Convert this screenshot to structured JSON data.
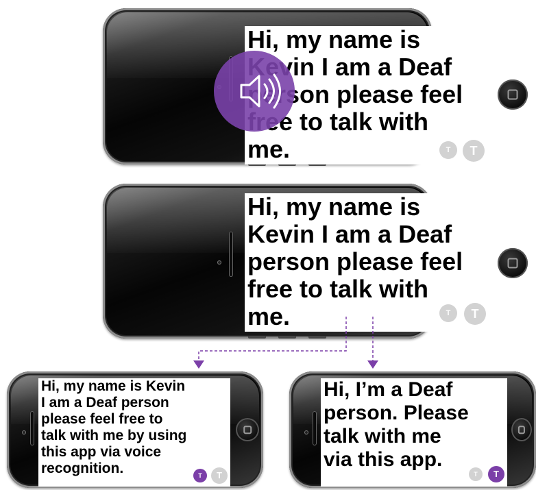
{
  "phones": {
    "top": {
      "message": "Hi, my name is\nKevin I am a Deaf\nperson please feel\nfree to talk with\nme.",
      "small_button": "T",
      "large_button": "T"
    },
    "middle": {
      "message": "Hi, my name is\nKevin I am a Deaf\nperson please feel\nfree to talk with\nme.",
      "small_button": "T",
      "large_button": "T"
    },
    "bottom_left": {
      "message": "Hi, my name is Kevin\nI am a Deaf person\nplease feel free to\ntalk with me by using\nthis app via voice\nrecognition.",
      "small_button": "T",
      "large_button": "T"
    },
    "bottom_right": {
      "message": "Hi, I’m a Deaf\nperson. Please\ntalk with me\nvia this app.",
      "small_button": "T",
      "large_button": "T"
    }
  },
  "icons": {
    "overlay": "speaker-volume-icon",
    "home": "home-button-icon"
  },
  "colors": {
    "accent": "#7b3fa8",
    "inactive": "#d2d2d2",
    "connector": "#7b3fa8"
  }
}
